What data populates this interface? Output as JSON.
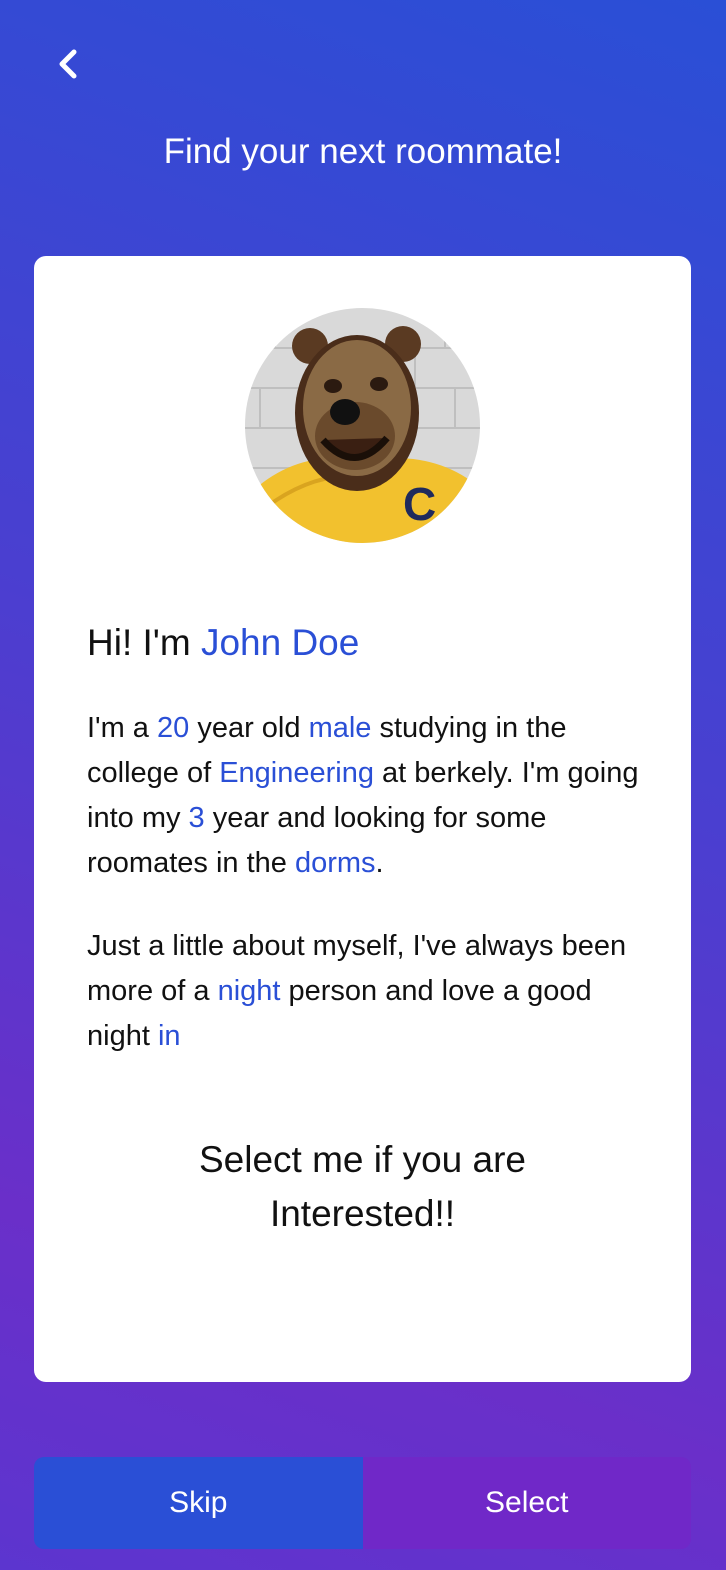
{
  "header": {
    "back_icon": "chevron-left-icon",
    "title": "Find your next roommate!"
  },
  "profile": {
    "avatar_description": "bear-mascot-avatar",
    "greeting_prefix": "Hi! I'm ",
    "name": "John Doe",
    "bio1": {
      "t1": "I'm a ",
      "age": "20",
      "t2": " year old ",
      "gender": "male",
      "t3": " studying in the college of ",
      "college": "Engineering",
      "t4": " at berkely. I'm going into my ",
      "year": "3",
      "t5": " year and looking for some roomates in the ",
      "housing": "dorms",
      "t6": "."
    },
    "bio2": {
      "t1": "Just a little about myself, I've always been more of a ",
      "time": "night",
      "t2": " person and love a good night ",
      "activity": "in"
    },
    "cta_line1": "Select me if you are",
    "cta_line2": "Interested!!"
  },
  "actions": {
    "skip_label": "Skip",
    "select_label": "Select"
  },
  "colors": {
    "accent_blue": "#2a4fd6",
    "accent_purple": "#7028c8",
    "card_bg": "#ffffff"
  }
}
